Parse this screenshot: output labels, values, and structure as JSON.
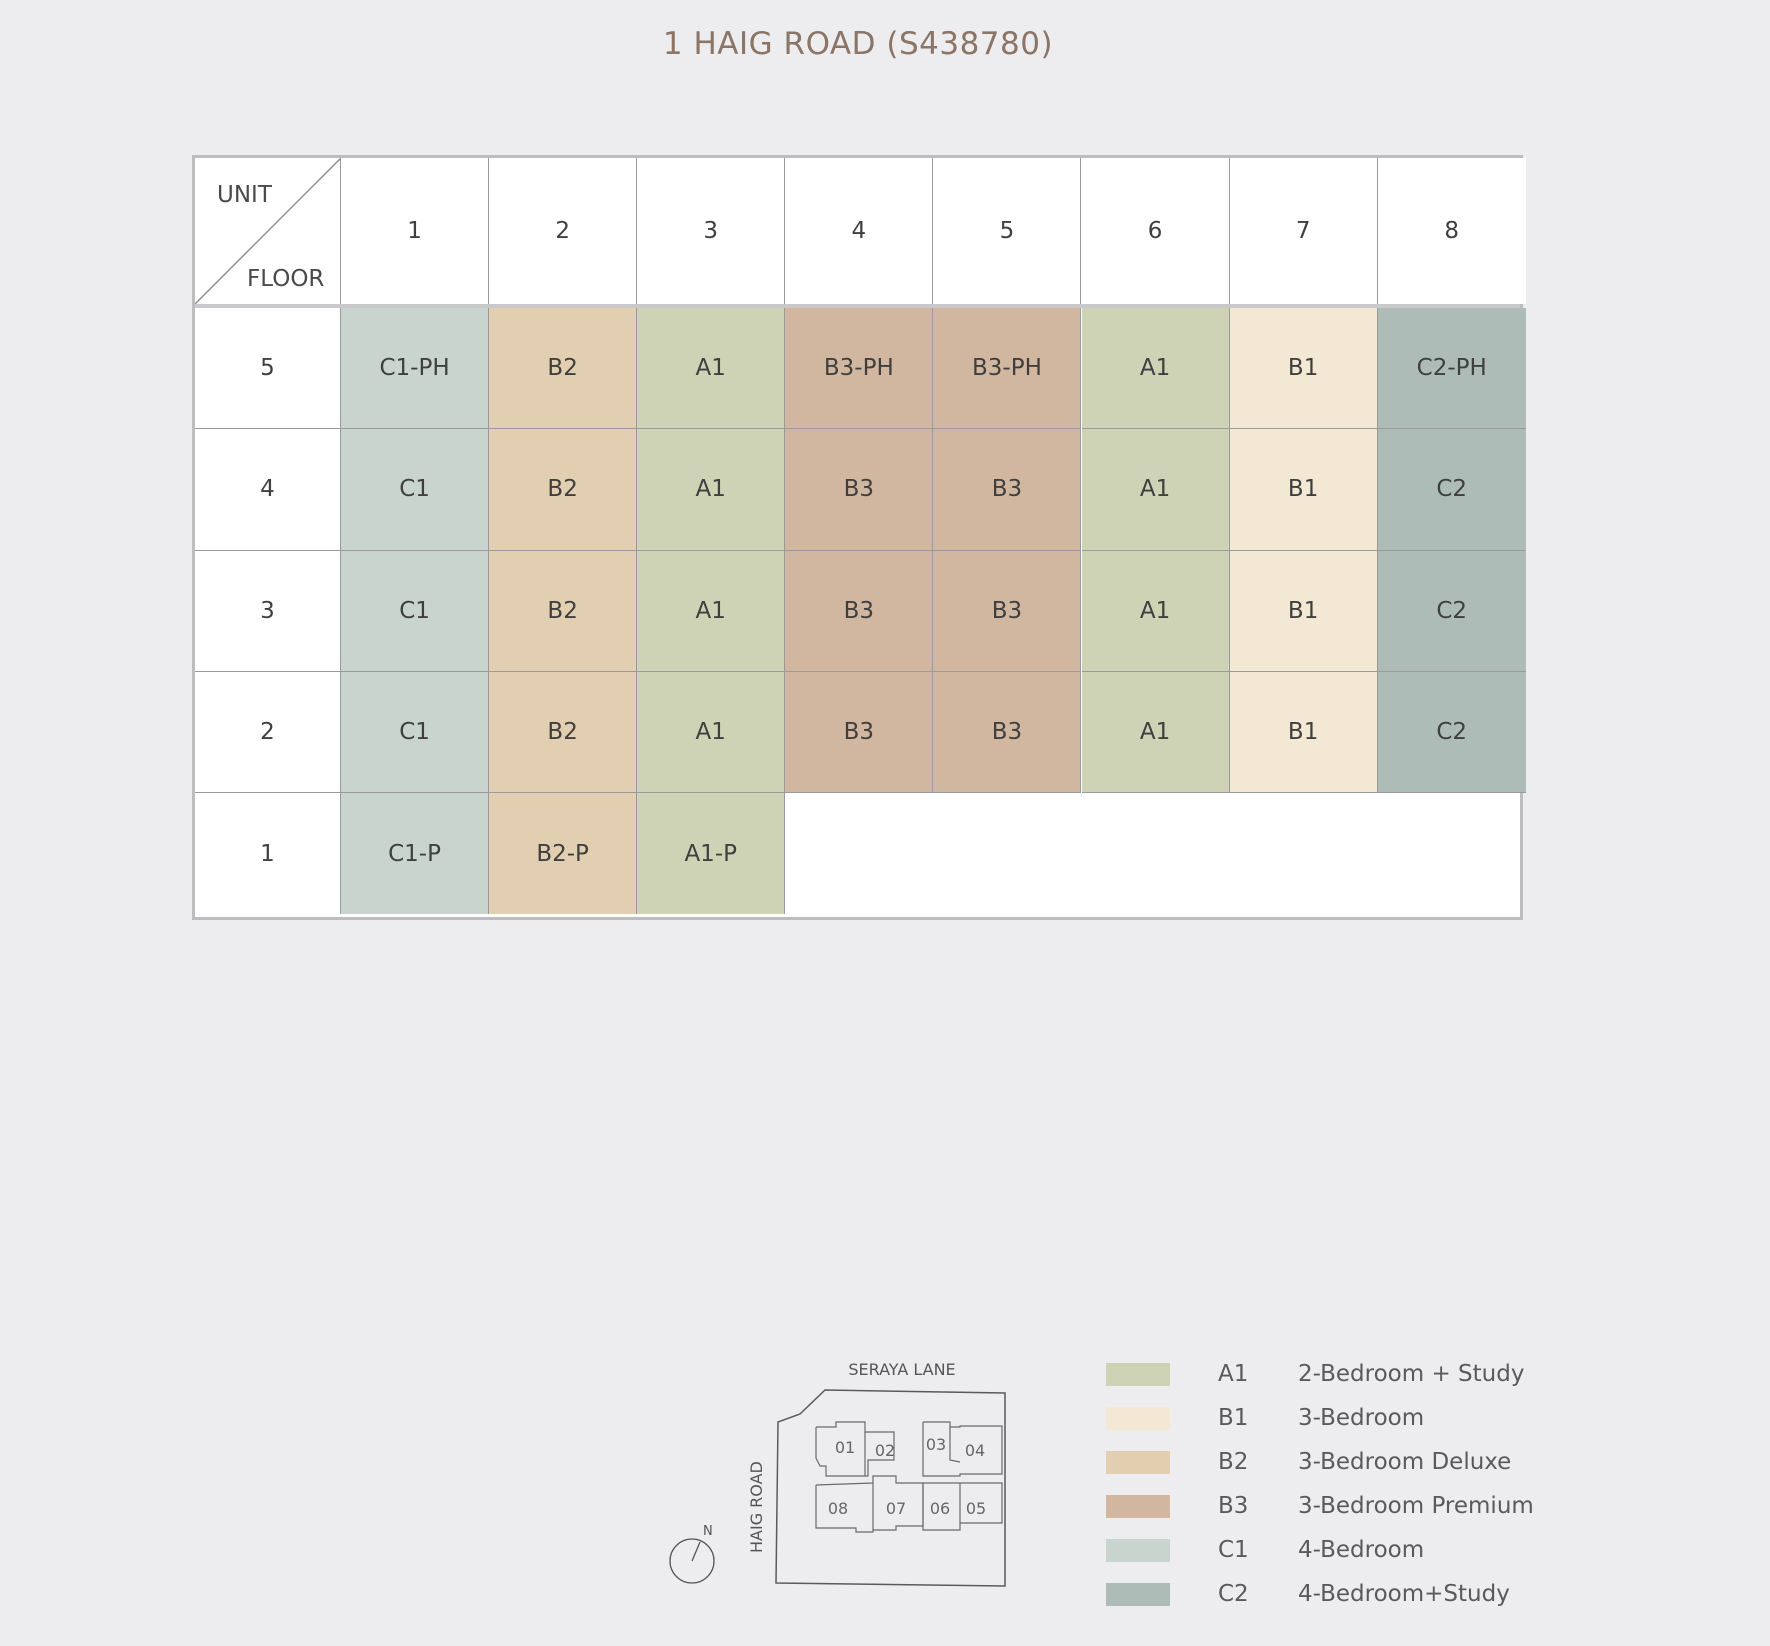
{
  "title": "1 HAIG ROAD (S438780)",
  "table": {
    "corner_top": "UNIT",
    "corner_bottom": "FLOOR",
    "units": [
      "1",
      "2",
      "3",
      "4",
      "5",
      "6",
      "7",
      "8"
    ],
    "rows": [
      {
        "floor": "5",
        "cells": [
          "C1-PH",
          "B2",
          "A1",
          "B3-PH",
          "B3-PH",
          "A1",
          "B1",
          "C2-PH"
        ]
      },
      {
        "floor": "4",
        "cells": [
          "C1",
          "B2",
          "A1",
          "B3",
          "B3",
          "A1",
          "B1",
          "C2"
        ]
      },
      {
        "floor": "3",
        "cells": [
          "C1",
          "B2",
          "A1",
          "B3",
          "B3",
          "A1",
          "B1",
          "C2"
        ]
      },
      {
        "floor": "2",
        "cells": [
          "C1",
          "B2",
          "A1",
          "B3",
          "B3",
          "A1",
          "B1",
          "C2"
        ]
      },
      {
        "floor": "1",
        "cells": [
          "C1-P",
          "B2-P",
          "A1-P",
          "",
          "",
          "",
          "",
          ""
        ]
      }
    ]
  },
  "type_colors": {
    "A1": "#cfd3b6",
    "B1": "#f3e8d3",
    "B2": "#e2cfb1",
    "B3": "#d1b7a0",
    "C1": "#c9d4cf",
    "C2": "#adbcb7"
  },
  "site_plan": {
    "top_road": "SERAYA LANE",
    "left_road": "HAIG ROAD",
    "north_label": "N",
    "blocks": [
      "01",
      "02",
      "03",
      "04",
      "05",
      "06",
      "07",
      "08"
    ]
  },
  "legend": [
    {
      "code": "A1",
      "desc": "2-Bedroom + Study"
    },
    {
      "code": "B1",
      "desc": "3-Bedroom"
    },
    {
      "code": "B2",
      "desc": "3-Bedroom Deluxe"
    },
    {
      "code": "B3",
      "desc": "3-Bedroom Premium"
    },
    {
      "code": "C1",
      "desc": "4-Bedroom"
    },
    {
      "code": "C2",
      "desc": "4-Bedroom+Study"
    }
  ]
}
